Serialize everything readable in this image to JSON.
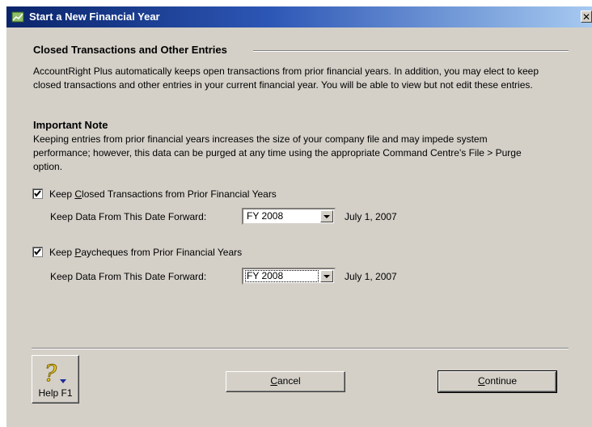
{
  "window": {
    "title": "Start a New Financial Year",
    "close_glyph": "✕"
  },
  "section": {
    "heading": "Closed Transactions and Other Entries",
    "intro": "AccountRight Plus automatically keeps open transactions from prior financial years. In addition, you may elect to keep closed transactions and other entries in your current financial year. You will be able to view but not edit these entries."
  },
  "note": {
    "heading": "Important Note",
    "text": "Keeping entries from prior financial years increases the size of your company file and may impede system performance; however, this data can be purged at any time using the appropriate Command Centre's File > Purge option."
  },
  "options": [
    {
      "checked": true,
      "label_before": "Keep ",
      "label_mnemonic": "C",
      "label_after": "losed Transactions from Prior Financial Years",
      "date_label": "Keep Data From This Date Forward:",
      "select_value": "FY 2008",
      "date_value": "July 1, 2007"
    },
    {
      "checked": true,
      "label_before": "Keep ",
      "label_mnemonic": "P",
      "label_after": "aycheques from Prior Financial Years",
      "date_label": "Keep Data From This Date Forward:",
      "select_value": "FY 2008",
      "date_value": "July 1, 2007"
    }
  ],
  "buttons": {
    "help_label": "Help F1",
    "cancel_mnemonic": "C",
    "cancel_rest": "ancel",
    "continue_mnemonic": "C",
    "continue_rest": "ontinue"
  }
}
